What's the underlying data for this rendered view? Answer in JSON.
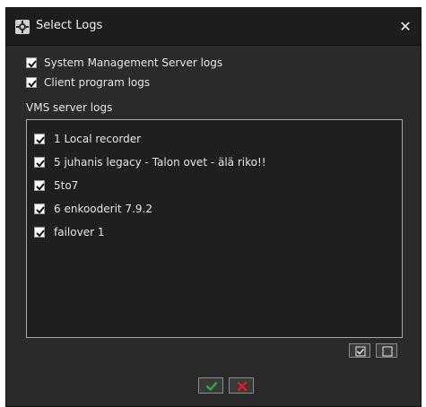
{
  "window": {
    "title": "Select Logs",
    "icon": "gear-icon",
    "close_icon": "close-icon"
  },
  "options": [
    {
      "label": "System Management Server logs",
      "checked": true
    },
    {
      "label": "Client program logs",
      "checked": true
    }
  ],
  "vms_section": {
    "label": "VMS server logs",
    "items": [
      {
        "label": "1  Local recorder",
        "checked": true
      },
      {
        "label": "5  juhanis legacy - Talon ovet - älä riko!!",
        "checked": true
      },
      {
        "label": "5to7",
        "checked": true
      },
      {
        "label": "6  enkooderit 7.9.2",
        "checked": true
      },
      {
        "label": "failover 1",
        "checked": true
      }
    ]
  },
  "list_controls": {
    "select_all_icon": "checkbox-checked-icon",
    "select_none_icon": "checkbox-empty-icon"
  },
  "dialog_buttons": {
    "ok_icon": "checkmark-icon",
    "cancel_icon": "x-icon"
  },
  "colors": {
    "dialog_bg": "#2a2a2a",
    "title_bg": "#1d1d1d",
    "list_bg": "#1f1f1f",
    "ok_green": "#28a745",
    "cancel_red": "#e01d1d"
  }
}
